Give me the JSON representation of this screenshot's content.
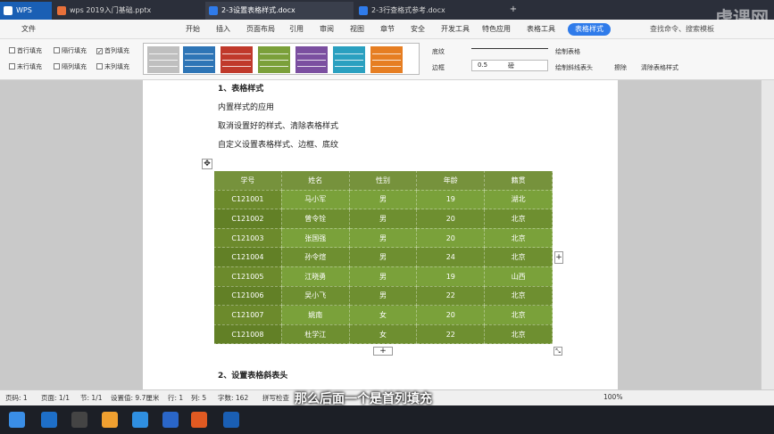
{
  "titlebar": {
    "app": "WPS",
    "tabs": [
      {
        "label": "wps 2019入门基础.pptx",
        "color": "#e8703a"
      },
      {
        "label": "2-3设置表格样式.docx",
        "color": "#2f7bea"
      },
      {
        "label": "2-3行查格式参考.docx",
        "color": "#2f7bea"
      }
    ],
    "watermark": "虎课网"
  },
  "menubar": {
    "file": "文件",
    "items": [
      "开始",
      "插入",
      "页面布局",
      "引用",
      "审阅",
      "视图",
      "章节",
      "安全",
      "开发工具",
      "特色应用",
      "表格工具"
    ],
    "selected": "表格样式",
    "search": "查找命令、搜索模板"
  },
  "ribbon": {
    "checks": [
      {
        "label": "首行填充",
        "checked": false
      },
      {
        "label": "隔行填充",
        "checked": false
      },
      {
        "label": "首列填充",
        "checked": true
      },
      {
        "label": "末行填充",
        "checked": false
      },
      {
        "label": "隔列填充",
        "checked": false
      },
      {
        "label": "末列填充",
        "checked": false
      }
    ],
    "swatches": [
      "#bfbfbf",
      "#2e75b6",
      "#c0392b",
      "#7ba03a",
      "#7b4fa0",
      "#2aa0c0",
      "#e67e22"
    ],
    "shading": "底纹",
    "border": "边框",
    "line_width": "0.5",
    "line_unit": "磅",
    "draw_table": "绘制表格",
    "draw_diagonal": "绘制斜线表头",
    "erase": "擦除",
    "clear_style": "清除表格样式"
  },
  "doc": {
    "heading1": "1、表格样式",
    "line1": "内置样式的应用",
    "line2": "取消设置好的样式、清除表格样式",
    "line3": "自定义设置表格样式、边框、底纹",
    "heading2": "2、设置表格斜表头"
  },
  "table": {
    "headers": [
      "学号",
      "姓名",
      "性别",
      "年龄",
      "籍贯"
    ],
    "rows": [
      [
        "C121001",
        "马小军",
        "男",
        "19",
        "湖北"
      ],
      [
        "C121002",
        "曾令铨",
        "男",
        "20",
        "北京"
      ],
      [
        "C121003",
        "张国强",
        "男",
        "20",
        "北京"
      ],
      [
        "C121004",
        "孙令煊",
        "男",
        "24",
        "北京"
      ],
      [
        "C121005",
        "江晓勇",
        "男",
        "19",
        "山西"
      ],
      [
        "C121006",
        "吴小飞",
        "男",
        "22",
        "北京"
      ],
      [
        "C121007",
        "姚南",
        "女",
        "20",
        "北京"
      ],
      [
        "C121008",
        "杜学江",
        "女",
        "22",
        "北京"
      ]
    ]
  },
  "statusbar": {
    "page_num": "页码: 1",
    "pages": "页面: 1/1",
    "section": "节: 1/1",
    "position": "设置值: 9.7厘米",
    "row": "行: 1",
    "col": "列: 5",
    "words": "字数: 162",
    "spell": "拼写检查",
    "zoom": "100%"
  },
  "subtitle": "那么后面一个是首列填充"
}
